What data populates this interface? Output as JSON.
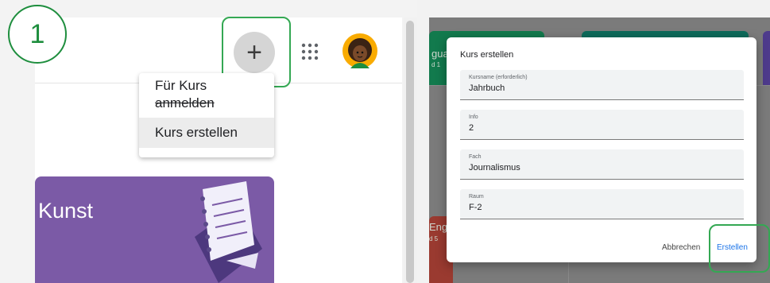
{
  "step": {
    "number": "1"
  },
  "toolbar": {
    "add_icon": "+",
    "apps_icon": "apps-grid-icon",
    "avatar": "user-avatar"
  },
  "menu": {
    "join_line1": "Für Kurs",
    "join_line2": "anmelden",
    "create": "Kurs erstellen"
  },
  "class_card": {
    "title": "Kunst",
    "color": "#7b5aa6"
  },
  "dialog": {
    "title": "Kurs erstellen",
    "fields": [
      {
        "label": "Kursname (erforderlich)",
        "value": "Jahrbuch"
      },
      {
        "label": "Info",
        "value": "2"
      },
      {
        "label": "Fach",
        "value": "Journalismus"
      },
      {
        "label": "Raum",
        "value": "F-2"
      }
    ],
    "cancel": "Abbrechen",
    "create": "Erstellen"
  },
  "background": {
    "tile1_title": "gua",
    "tile1_sub": "d 1",
    "tile2_title": "Eng",
    "tile2_sub": "d 5"
  },
  "colors": {
    "accent_green": "#34a853",
    "primary_blue": "#1a73e8",
    "card_purple": "#7b5aa6"
  }
}
